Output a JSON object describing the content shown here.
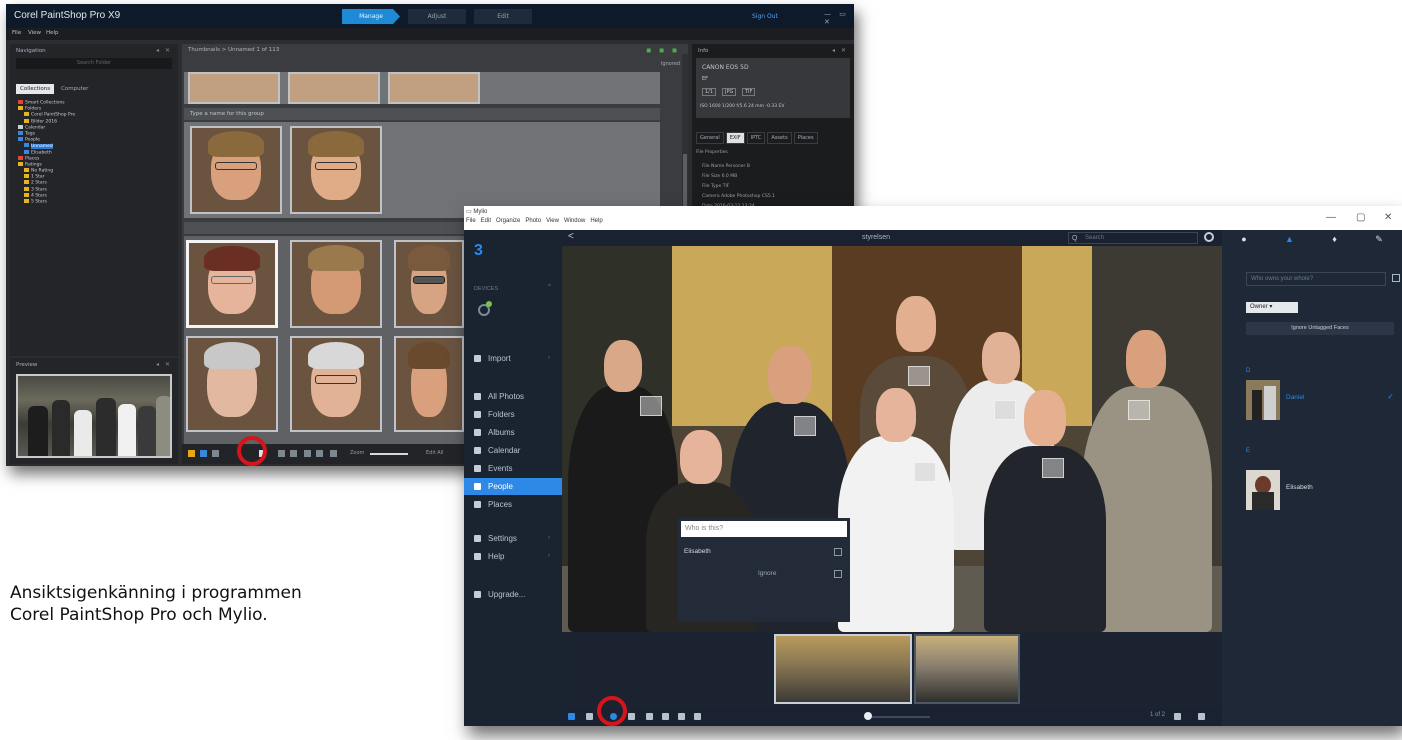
{
  "caption": {
    "line1": "Ansiktsigenkänning i programmen",
    "line2": "Corel PaintShop Pro och Mylio."
  },
  "corel": {
    "app_title": "Corel PaintShop Pro X9",
    "tabs": [
      "Manage",
      "Adjust",
      "Edit"
    ],
    "user_label": "Sign Out",
    "window_controls": "— ▭ ✕",
    "menu": [
      "File",
      "View",
      "Help"
    ],
    "nav_panel_title": "Navigation",
    "nav_search_placeholder": "Search Folder",
    "nav_tabs": [
      "Collections",
      "Computer"
    ],
    "tree": [
      {
        "label": "Smart Collections",
        "color": "#e0453a",
        "selected": false
      },
      {
        "label": "Folders",
        "color": "#e6b422",
        "selected": false
      },
      {
        "label": "Corel PaintShop Pro",
        "color": "#e6b422",
        "selected": false
      },
      {
        "label": "Bilder 2016",
        "color": "#e6b422",
        "selected": false
      },
      {
        "label": "Calendar",
        "color": "#c8ced4",
        "selected": false
      },
      {
        "label": "Tags",
        "color": "#3b88d9",
        "selected": false
      },
      {
        "label": "People",
        "color": "#3b88d9",
        "selected": false
      },
      {
        "label": "Unnamed",
        "color": "#3b88d9",
        "selected": true
      },
      {
        "label": "Elisabeth",
        "color": "#3b88d9",
        "selected": false
      },
      {
        "label": "Places",
        "color": "#e0453a",
        "selected": false
      },
      {
        "label": "Ratings",
        "color": "#e6b422",
        "selected": false
      },
      {
        "label": "No Rating",
        "color": "#e6b422",
        "selected": false
      },
      {
        "label": "1 Star",
        "color": "#e6b422",
        "selected": false
      },
      {
        "label": "2 Stars",
        "color": "#e6b422",
        "selected": false
      },
      {
        "label": "3 Stars",
        "color": "#e6b422",
        "selected": false
      },
      {
        "label": "4 Stars",
        "color": "#e6b422",
        "selected": false
      },
      {
        "label": "5 Stars",
        "color": "#e6b422",
        "selected": false
      }
    ],
    "preview_title": "Preview",
    "breadcrumb": "Thumbnails  >  Unnamed  1 of 113",
    "sort_label": "Ignored",
    "group_prompt": "Type a name for this group",
    "unassigned_label": "Unassigned",
    "zoom_label": "Zoom",
    "bottom_label": "Edit All",
    "info_title": "Info",
    "camera_model": "CANON EOS 5D",
    "lens": "EF",
    "info_badges": [
      "1/1",
      "JPG",
      "TIF"
    ],
    "exif_row": "ISO 1600   1/200   f/5.6   24 mm   -0.33 EV",
    "info_tabs": [
      "General",
      "EXIF",
      "IPTC",
      "Assets",
      "Places"
    ],
    "info_section": "File Properties",
    "info_lines": [
      "File Name  Personer B",
      "File Size  6.0 MB",
      "File Type  TIF",
      "Camera  Adobe Photoshop CS5.1",
      "Date  2016-03-12 13:24"
    ]
  },
  "mylio": {
    "window_title": "Mylio",
    "menu": [
      "File",
      "Edit",
      "Organize",
      "Photo",
      "View",
      "Window",
      "Help"
    ],
    "window_controls": [
      "—",
      "▢",
      "✕"
    ],
    "brand": "3",
    "devices_label": "DEVICES",
    "nav": [
      {
        "label": "Import",
        "chevron": true,
        "active": false
      },
      {
        "label": "All Photos",
        "chevron": false,
        "active": false
      },
      {
        "label": "Folders",
        "chevron": false,
        "active": false
      },
      {
        "label": "Albums",
        "chevron": false,
        "active": false
      },
      {
        "label": "Calendar",
        "chevron": false,
        "active": false
      },
      {
        "label": "Events",
        "chevron": false,
        "active": false
      },
      {
        "label": "People",
        "chevron": false,
        "active": true
      },
      {
        "label": "Places",
        "chevron": false,
        "active": false
      },
      {
        "label": "Settings",
        "chevron": true,
        "active": false
      },
      {
        "label": "Help",
        "chevron": true,
        "active": false
      },
      {
        "label": "Upgrade...",
        "chevron": false,
        "active": false
      }
    ],
    "back_glyph": "<",
    "filename": "styrelsen",
    "search_placeholder": "Search",
    "who_placeholder": "Who is this?",
    "who_suggestion": "Elisabeth",
    "who_ignore": "Ignore",
    "count_label": "1 of 2",
    "right_who_placeholder": "Who owns your whole?",
    "owner_select": "Owner",
    "ignore_button": "Ignore Untagged Faces",
    "section_a": "D",
    "section_b": "E",
    "person_a": "Daniel",
    "person_b": "Elisabeth",
    "accent": "#2e88e6"
  }
}
